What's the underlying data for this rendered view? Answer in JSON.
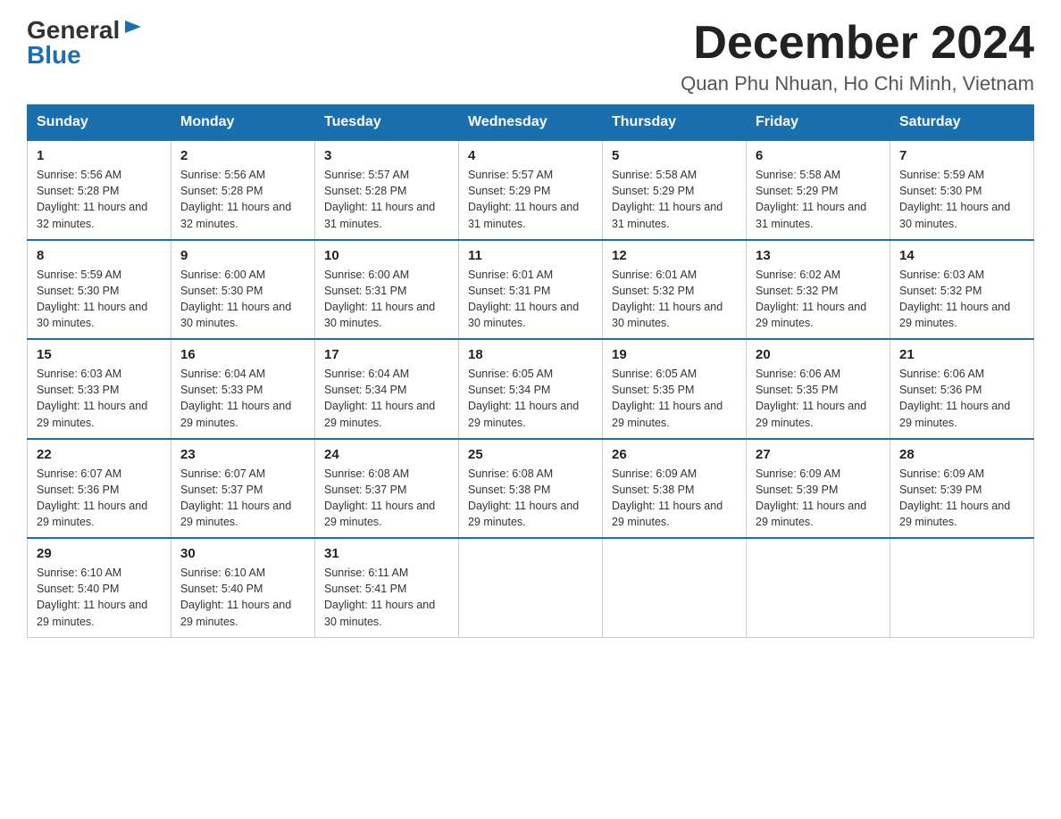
{
  "logo": {
    "general": "General",
    "blue": "Blue",
    "triangle_symbol": "▶"
  },
  "title": "December 2024",
  "subtitle": "Quan Phu Nhuan, Ho Chi Minh, Vietnam",
  "weekdays": [
    "Sunday",
    "Monday",
    "Tuesday",
    "Wednesday",
    "Thursday",
    "Friday",
    "Saturday"
  ],
  "weeks": [
    [
      {
        "day": "1",
        "sunrise": "5:56 AM",
        "sunset": "5:28 PM",
        "daylight": "11 hours and 32 minutes."
      },
      {
        "day": "2",
        "sunrise": "5:56 AM",
        "sunset": "5:28 PM",
        "daylight": "11 hours and 32 minutes."
      },
      {
        "day": "3",
        "sunrise": "5:57 AM",
        "sunset": "5:28 PM",
        "daylight": "11 hours and 31 minutes."
      },
      {
        "day": "4",
        "sunrise": "5:57 AM",
        "sunset": "5:29 PM",
        "daylight": "11 hours and 31 minutes."
      },
      {
        "day": "5",
        "sunrise": "5:58 AM",
        "sunset": "5:29 PM",
        "daylight": "11 hours and 31 minutes."
      },
      {
        "day": "6",
        "sunrise": "5:58 AM",
        "sunset": "5:29 PM",
        "daylight": "11 hours and 31 minutes."
      },
      {
        "day": "7",
        "sunrise": "5:59 AM",
        "sunset": "5:30 PM",
        "daylight": "11 hours and 30 minutes."
      }
    ],
    [
      {
        "day": "8",
        "sunrise": "5:59 AM",
        "sunset": "5:30 PM",
        "daylight": "11 hours and 30 minutes."
      },
      {
        "day": "9",
        "sunrise": "6:00 AM",
        "sunset": "5:30 PM",
        "daylight": "11 hours and 30 minutes."
      },
      {
        "day": "10",
        "sunrise": "6:00 AM",
        "sunset": "5:31 PM",
        "daylight": "11 hours and 30 minutes."
      },
      {
        "day": "11",
        "sunrise": "6:01 AM",
        "sunset": "5:31 PM",
        "daylight": "11 hours and 30 minutes."
      },
      {
        "day": "12",
        "sunrise": "6:01 AM",
        "sunset": "5:32 PM",
        "daylight": "11 hours and 30 minutes."
      },
      {
        "day": "13",
        "sunrise": "6:02 AM",
        "sunset": "5:32 PM",
        "daylight": "11 hours and 29 minutes."
      },
      {
        "day": "14",
        "sunrise": "6:03 AM",
        "sunset": "5:32 PM",
        "daylight": "11 hours and 29 minutes."
      }
    ],
    [
      {
        "day": "15",
        "sunrise": "6:03 AM",
        "sunset": "5:33 PM",
        "daylight": "11 hours and 29 minutes."
      },
      {
        "day": "16",
        "sunrise": "6:04 AM",
        "sunset": "5:33 PM",
        "daylight": "11 hours and 29 minutes."
      },
      {
        "day": "17",
        "sunrise": "6:04 AM",
        "sunset": "5:34 PM",
        "daylight": "11 hours and 29 minutes."
      },
      {
        "day": "18",
        "sunrise": "6:05 AM",
        "sunset": "5:34 PM",
        "daylight": "11 hours and 29 minutes."
      },
      {
        "day": "19",
        "sunrise": "6:05 AM",
        "sunset": "5:35 PM",
        "daylight": "11 hours and 29 minutes."
      },
      {
        "day": "20",
        "sunrise": "6:06 AM",
        "sunset": "5:35 PM",
        "daylight": "11 hours and 29 minutes."
      },
      {
        "day": "21",
        "sunrise": "6:06 AM",
        "sunset": "5:36 PM",
        "daylight": "11 hours and 29 minutes."
      }
    ],
    [
      {
        "day": "22",
        "sunrise": "6:07 AM",
        "sunset": "5:36 PM",
        "daylight": "11 hours and 29 minutes."
      },
      {
        "day": "23",
        "sunrise": "6:07 AM",
        "sunset": "5:37 PM",
        "daylight": "11 hours and 29 minutes."
      },
      {
        "day": "24",
        "sunrise": "6:08 AM",
        "sunset": "5:37 PM",
        "daylight": "11 hours and 29 minutes."
      },
      {
        "day": "25",
        "sunrise": "6:08 AM",
        "sunset": "5:38 PM",
        "daylight": "11 hours and 29 minutes."
      },
      {
        "day": "26",
        "sunrise": "6:09 AM",
        "sunset": "5:38 PM",
        "daylight": "11 hours and 29 minutes."
      },
      {
        "day": "27",
        "sunrise": "6:09 AM",
        "sunset": "5:39 PM",
        "daylight": "11 hours and 29 minutes."
      },
      {
        "day": "28",
        "sunrise": "6:09 AM",
        "sunset": "5:39 PM",
        "daylight": "11 hours and 29 minutes."
      }
    ],
    [
      {
        "day": "29",
        "sunrise": "6:10 AM",
        "sunset": "5:40 PM",
        "daylight": "11 hours and 29 minutes."
      },
      {
        "day": "30",
        "sunrise": "6:10 AM",
        "sunset": "5:40 PM",
        "daylight": "11 hours and 29 minutes."
      },
      {
        "day": "31",
        "sunrise": "6:11 AM",
        "sunset": "5:41 PM",
        "daylight": "11 hours and 30 minutes."
      },
      null,
      null,
      null,
      null
    ]
  ]
}
